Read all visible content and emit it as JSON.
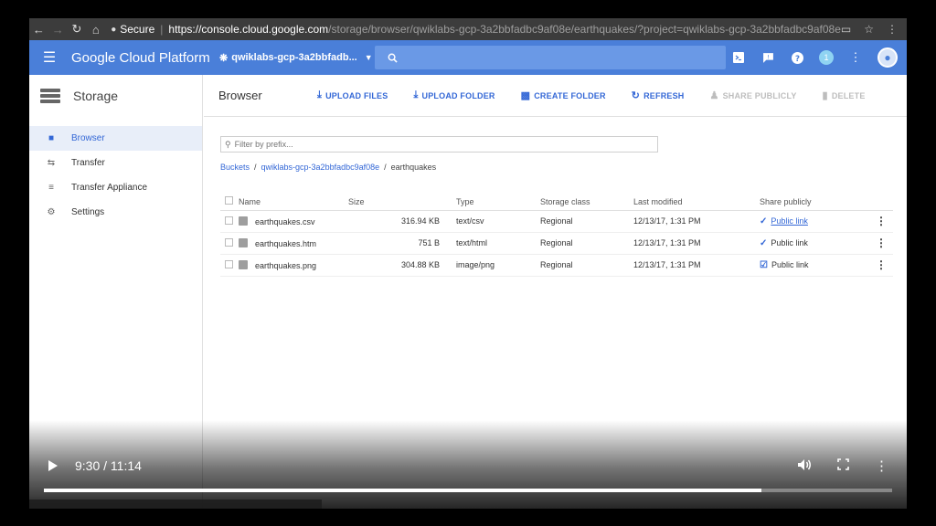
{
  "browser": {
    "secure_label": "Secure",
    "url_host": "https://console.cloud.google.com",
    "url_rest": "/storage/browser/qwiklabs-gcp-3a2bbfadbc9af08e/earthquakes/?project=qwiklabs-gcp-3a2bbfadbc9af08e",
    "icons": [
      "back-icon",
      "forward-icon",
      "reload-icon",
      "home-icon",
      "lock-icon",
      "cast-icon",
      "star-icon",
      "menu-dots-icon"
    ]
  },
  "header": {
    "title": "Google Cloud Platform",
    "project": "qwiklabs-gcp-3a2bbfadb...",
    "notification_count": "1",
    "color": "#4a7fd9"
  },
  "sidebar": {
    "title": "Storage",
    "items": [
      {
        "label": "Browser",
        "icon": "bucket-icon",
        "active": true
      },
      {
        "label": "Transfer",
        "icon": "transfer-icon",
        "active": false
      },
      {
        "label": "Transfer Appliance",
        "icon": "appliance-icon",
        "active": false
      },
      {
        "label": "Settings",
        "icon": "gear-icon",
        "active": false
      }
    ]
  },
  "main": {
    "title": "Browser",
    "toolbar": {
      "upload_files": "UPLOAD FILES",
      "upload_folder": "UPLOAD FOLDER",
      "create_folder": "CREATE FOLDER",
      "refresh": "REFRESH",
      "share_publicly": "SHARE PUBLICLY",
      "delete": "DELETE"
    },
    "filter_placeholder": "Filter by prefix...",
    "breadcrumb": [
      "Buckets",
      "qwiklabs-gcp-3a2bbfadbc9af08e",
      "earthquakes"
    ],
    "columns": [
      "Name",
      "Size",
      "Type",
      "Storage class",
      "Last modified",
      "Share publicly"
    ],
    "rows": [
      {
        "name": "earthquakes.csv",
        "size": "316.94 KB",
        "type": "text/csv",
        "class": "Regional",
        "modified": "12/13/17, 1:31 PM",
        "share": "Public link",
        "linked": true
      },
      {
        "name": "earthquakes.htm",
        "size": "751 B",
        "type": "text/html",
        "class": "Regional",
        "modified": "12/13/17, 1:31 PM",
        "share": "Public link",
        "linked": false
      },
      {
        "name": "earthquakes.png",
        "size": "304.88 KB",
        "type": "image/png",
        "class": "Regional",
        "modified": "12/13/17, 1:31 PM",
        "share": "Public link",
        "linked": false
      }
    ]
  },
  "video": {
    "time": "9:30 / 11:14",
    "progress": 0.846
  }
}
